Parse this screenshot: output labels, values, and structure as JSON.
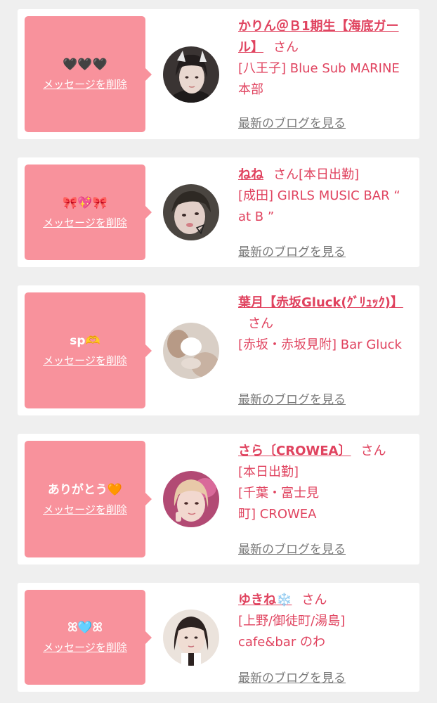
{
  "messages": [
    {
      "bubble_text": "🖤🖤🖤",
      "delete_label": "メッセージを削除",
      "name": "かりん＠Ｂ1期生【海底ガール】",
      "honorific": "さん",
      "status": "",
      "shop": "[八王子] Blue Sub MARINE 本部",
      "blog_label": "最新のブログを見る"
    },
    {
      "bubble_text": "🎀💖🎀",
      "delete_label": "メッセージを削除",
      "name": "ねね",
      "honorific": "さん",
      "status": "[本日出勤]",
      "shop": "[成田] GIRLS MUSIC BAR “ at B ”",
      "blog_label": "最新のブログを見る"
    },
    {
      "bubble_text": "sp🫶",
      "delete_label": "メッセージを削除",
      "name": "葉月【赤坂Gluck(ｸﾞﾘｭｯｸ)】",
      "honorific": "さん",
      "status": "",
      "shop": "[赤坂・赤坂見附] Bar Gluck",
      "blog_label": "最新のブログを見る"
    },
    {
      "bubble_text": "ありがとう🧡",
      "delete_label": "メッセージを削除",
      "name": "さら〔CROWEA〕",
      "honorific": "さん",
      "status": "[本日出勤]",
      "shop": "[千葉・富士見町] CROWEA",
      "blog_label": "最新のブログを見る"
    },
    {
      "bubble_text": "ꕤ🩵ꕤ",
      "delete_label": "メッセージを削除",
      "name": "ゆきね❄️",
      "honorific": "さん",
      "status": "",
      "shop": "[上野/御徒町/湯島] cafe&bar のわ",
      "blog_label": "最新のブログを見る"
    }
  ],
  "colors": {
    "page_bg": "#efefef",
    "card_bg": "#ffffff",
    "bubble": "#f8929c",
    "accent_text": "#e0435f",
    "link_gray": "#7a7a7a"
  }
}
